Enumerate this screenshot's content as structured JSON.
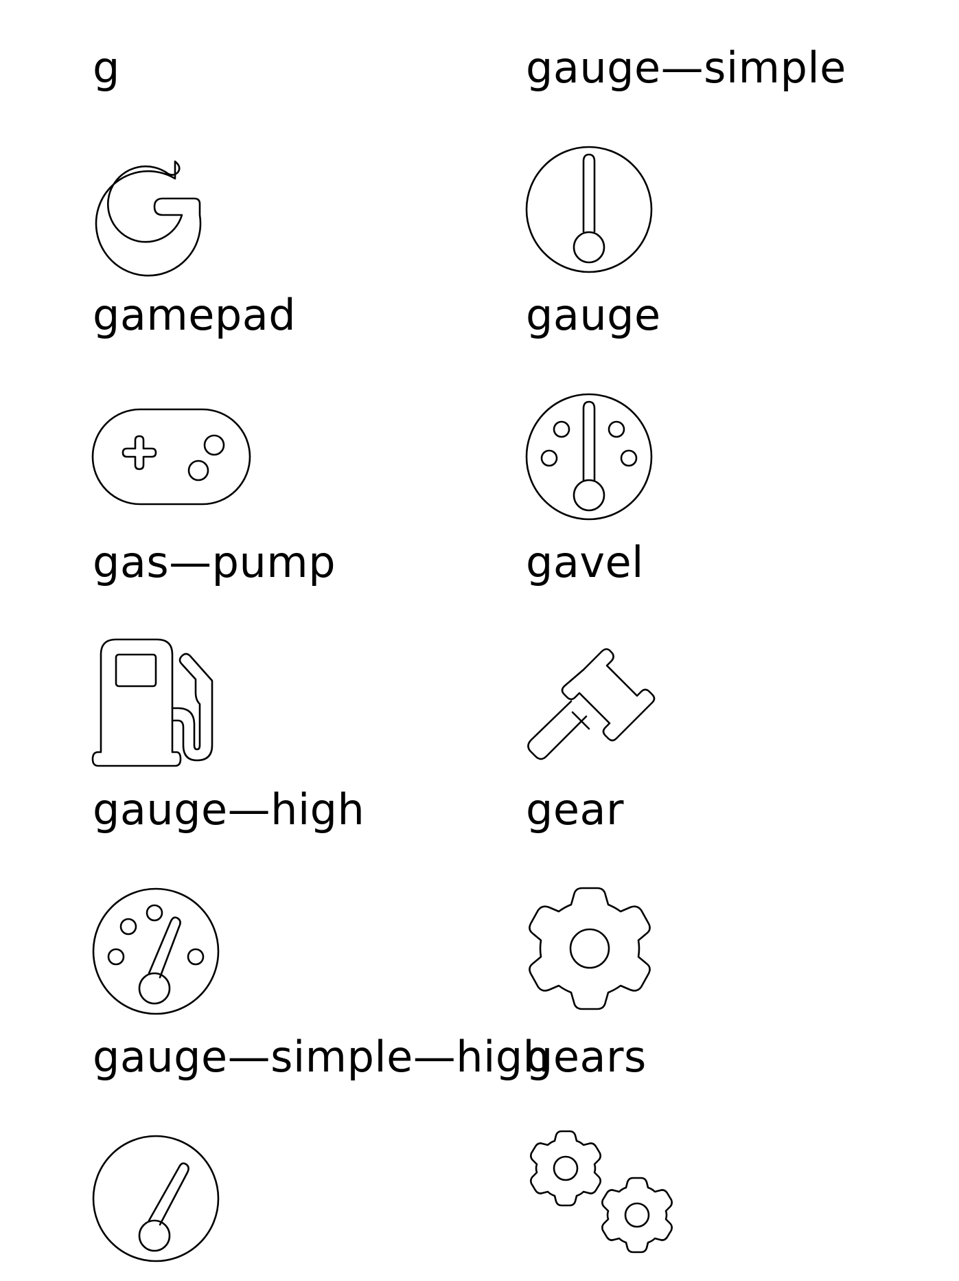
{
  "icons": [
    {
      "label": "g",
      "icon": "g-icon"
    },
    {
      "label": "gauge—simple",
      "icon": "gauge-simple-icon"
    },
    {
      "label": "gamepad",
      "icon": "gamepad-icon"
    },
    {
      "label": "gauge",
      "icon": "gauge-icon"
    },
    {
      "label": "gas—pump",
      "icon": "gas-pump-icon"
    },
    {
      "label": "gavel",
      "icon": "gavel-icon"
    },
    {
      "label": "gauge—high",
      "icon": "gauge-high-icon"
    },
    {
      "label": "gear",
      "icon": "gear-icon"
    },
    {
      "label": "gauge—simple—high",
      "icon": "gauge-simple-high-icon"
    },
    {
      "label": "gears",
      "icon": "gears-icon"
    }
  ]
}
